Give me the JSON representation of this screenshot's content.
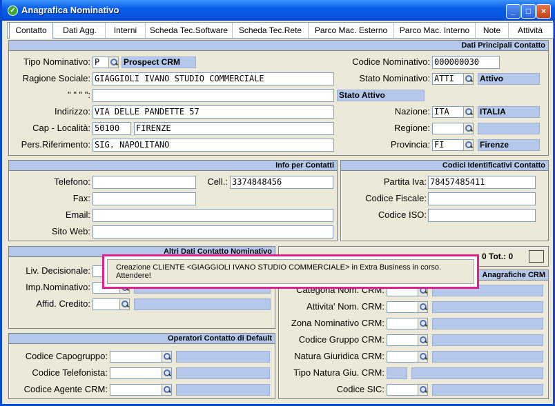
{
  "window": {
    "title": "Anagrafica Nominativo",
    "minimize_symbol": "_",
    "maximize_symbol": "□",
    "close_symbol": "×",
    "app_icon": "check-icon"
  },
  "tabs": [
    "Contatto",
    "Dati Agg.",
    "Interni",
    "Scheda Tec.Software",
    "Scheda Tec.Rete",
    "Parco Mac. Esterno",
    "Parco Mac. Interno",
    "Note",
    "Attività"
  ],
  "dati_principali": {
    "header": "Dati Principali Contatto",
    "tipo_label": "Tipo Nominativo:",
    "tipo_value": "P",
    "tipo_desc": "Prospect CRM",
    "codice_label": "Codice Nominativo:",
    "codice_value": "000000030",
    "ragione_label": "Ragione Sociale:",
    "ragione_value": "GIAGGIOLI IVANO STUDIO COMMERCIALE",
    "stato_label": "Stato Nominativo:",
    "stato_value": "ATTI",
    "stato_desc": "Attivo",
    "cont_label": "\" \" \" \":",
    "cont_value": "",
    "stato_attivo": "Stato Attivo",
    "indirizzo_label": "Indirizzo:",
    "indirizzo_value": "VIA DELLE PANDETTE 57",
    "nazione_label": "Nazione:",
    "nazione_value": "ITA",
    "nazione_desc": "ITALIA",
    "cap_label": "Cap - Località:",
    "cap_value": "50100",
    "localita_value": "FIRENZE",
    "regione_label": "Regione:",
    "regione_value": "",
    "regione_desc": "",
    "pers_label": "Pers.Riferimento:",
    "pers_value": "SIG. NAPOLITANO",
    "provincia_label": "Provincia:",
    "provincia_value": "FI",
    "provincia_desc": "Firenze"
  },
  "info_contatti": {
    "header": "Info per Contatti",
    "telefono_label": "Telefono:",
    "telefono_value": "",
    "cell_label": "Cell.:",
    "cell_value": "3374848456",
    "fax_label": "Fax:",
    "fax_value": "",
    "email_label": "Email:",
    "email_value": "",
    "sito_label": "Sito Web:",
    "sito_value": ""
  },
  "codici": {
    "header": "Codici Identificativi Contatto",
    "piva_label": "Partita Iva:",
    "piva_value": "78457485411",
    "cf_label": "Codice Fiscale:",
    "cf_value": "",
    "iso_label": "Codice ISO:",
    "iso_value": ""
  },
  "altri_dati": {
    "header": "Altri Dati Contatto Nominativo",
    "liv_label": "Liv. Decisionale:",
    "imp_label": "Imp.Nominativo:",
    "affid_label": "Affid. Credito:"
  },
  "tot": {
    "text": "0 Tot.: 0"
  },
  "anagrafiche": {
    "header": "Anagrafiche CRM",
    "categoria_label": "Categoria Nom. CRM:",
    "attivita_label": "Attivita' Nom. CRM:",
    "zona_label": "Zona Nominativo CRM:",
    "gruppo_label": "Codice Gruppo CRM:",
    "natura_label": "Natura Giuridica CRM:",
    "tipo_natura_label": "Tipo Natura Giu. CRM:",
    "sic_label": "Codice SIC:"
  },
  "operatori": {
    "header": "Operatori Contatto di Default",
    "capogruppo_label": "Codice Capogruppo:",
    "telefonista_label": "Codice Telefonista:",
    "agente_label": "Codice Agente CRM:"
  },
  "popup": {
    "message": "Creazione CLIENTE <GIAGGIOLI IVANO STUDIO COMMERCIALE> in Extra Business in corso. Attendere!"
  }
}
